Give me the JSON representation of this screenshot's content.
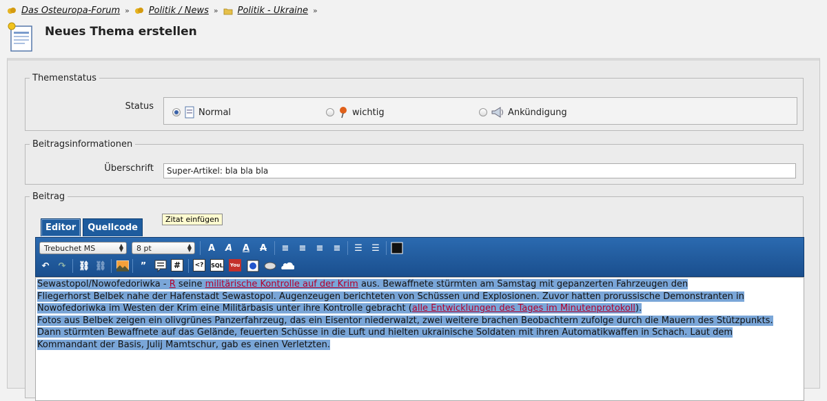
{
  "breadcrumb": [
    {
      "label": "Das Osteuropa-Forum"
    },
    {
      "label": "Politik / News"
    },
    {
      "label": "Politik - Ukraine"
    }
  ],
  "breadcrumb_sep": "»",
  "page_title": "Neues Thema erstellen",
  "themenstatus": {
    "legend": "Themenstatus",
    "status_label": "Status",
    "options": [
      {
        "label": "Normal",
        "selected": true
      },
      {
        "label": "wichtig",
        "selected": false
      },
      {
        "label": "Ankündigung",
        "selected": false
      }
    ]
  },
  "beitragsinfo": {
    "legend": "Beitragsinformationen",
    "title_label": "Überschrift",
    "title_value": "Super-Artikel: bla bla bla"
  },
  "beitrag": {
    "legend": "Beitrag",
    "tabs": [
      "Editor",
      "Quellcode"
    ],
    "font_select": "Trebuchet MS",
    "size_select": "8 pt",
    "tooltip": "Zitat einfügen",
    "text": {
      "l1_a": "Sewastopol/Nowofedoriwka - ",
      "l1_b": "R",
      "l1_c": " seine ",
      "l1_link": "militärische Kontrolle auf der Krim",
      "l1_d": " aus. Bewaffnete stürmten am Samstag mit gepanzerten Fahrzeugen den",
      "l2": "Fliegerhorst Belbek nahe der Hafenstadt Sewastopol. Augenzeugen berichteten von Schüssen und Explosionen. Zuvor hatten prorussische Demonstranten in",
      "l3_a": "Nowofedoriwka im Westen der Krim eine Militärbasis unter ihre Kontrolle gebracht (",
      "l3_link": "alle Entwicklungen des Tages im Minutenprotokoll",
      "l3_b": ").",
      "l4": "Fotos aus Belbek zeigen ein olivgrünes Panzerfahrzeug, das ein Eisentor niederwalzt, zwei weitere brachen Beobachtern zufolge durch die Mauern des Stützpunkts.",
      "l5": "Dann stürmten Bewaffnete auf das Gelände, feuerten Schüsse in die Luft und hielten ukrainische Soldaten mit ihren Automatikwaffen in Schach. Laut dem",
      "l6": "Kommandant der Basis, Julij Mamtschur, gab es einen Verletzten."
    }
  },
  "colors": {
    "toolbar": "#1f5a9c",
    "link": "#b3002d",
    "selection": "#7aa6d8"
  }
}
